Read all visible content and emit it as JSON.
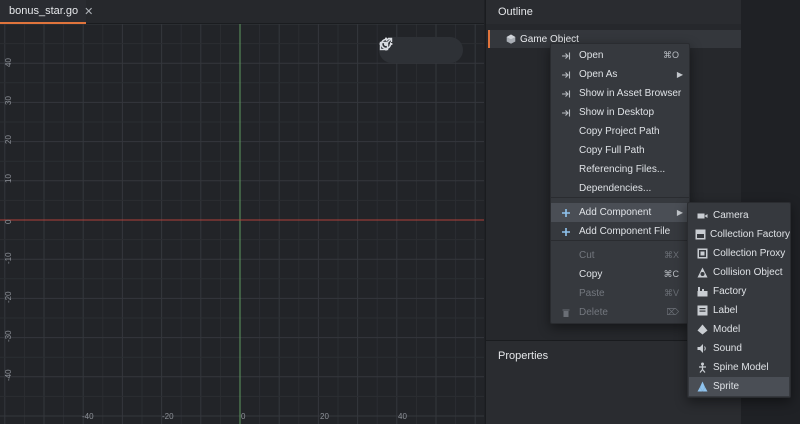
{
  "tab": {
    "label": "bonus_star.go",
    "close": "✕"
  },
  "viewport": {
    "x_ticks": [
      "-40",
      "-20",
      "0",
      "20",
      "40"
    ],
    "y_ticks": [
      "40",
      "30",
      "20",
      "10",
      "0",
      "-10",
      "-20",
      "-30",
      "-40"
    ]
  },
  "outline": {
    "title": "Outline",
    "root_label": "Game Object"
  },
  "properties": {
    "title": "Properties"
  },
  "context_menu": {
    "items": [
      {
        "label": "Open",
        "shortcut": "⌘O",
        "icon": "open-icon",
        "disabled": false
      },
      {
        "label": "Open As",
        "shortcut": "",
        "icon": "open-as-icon",
        "disabled": false,
        "submenu": true
      },
      {
        "label": "Show in Asset Browser",
        "shortcut": "",
        "icon": "show-asset-icon",
        "disabled": false
      },
      {
        "label": "Show in Desktop",
        "shortcut": "",
        "icon": "show-desktop-icon",
        "disabled": false
      },
      {
        "label": "Copy Project Path",
        "shortcut": "",
        "icon": "",
        "disabled": false
      },
      {
        "label": "Copy Full Path",
        "shortcut": "",
        "icon": "",
        "disabled": false
      },
      {
        "label": "Referencing Files...",
        "shortcut": "",
        "icon": "",
        "disabled": false
      },
      {
        "label": "Dependencies...",
        "shortcut": "",
        "icon": "",
        "disabled": false
      },
      {
        "label": "Add Component",
        "shortcut": "",
        "icon": "plus-icon",
        "disabled": false,
        "submenu": true,
        "active": true
      },
      {
        "label": "Add Component File",
        "shortcut": "",
        "icon": "plus-icon",
        "disabled": false
      },
      {
        "label": "Cut",
        "shortcut": "⌘X",
        "icon": "",
        "disabled": true
      },
      {
        "label": "Copy",
        "shortcut": "⌘C",
        "icon": "",
        "disabled": false
      },
      {
        "label": "Paste",
        "shortcut": "⌘V",
        "icon": "",
        "disabled": true
      },
      {
        "label": "Delete",
        "shortcut": "⌦",
        "icon": "trash-icon",
        "disabled": true
      }
    ]
  },
  "submenu": {
    "items": [
      {
        "label": "Camera",
        "icon": "camera-icon"
      },
      {
        "label": "Collection Factory",
        "icon": "collection-factory-icon"
      },
      {
        "label": "Collection Proxy",
        "icon": "collection-proxy-icon"
      },
      {
        "label": "Collision Object",
        "icon": "collision-object-icon"
      },
      {
        "label": "Factory",
        "icon": "factory-icon"
      },
      {
        "label": "Label",
        "icon": "label-icon"
      },
      {
        "label": "Model",
        "icon": "model-icon"
      },
      {
        "label": "Sound",
        "icon": "sound-icon"
      },
      {
        "label": "Spine Model",
        "icon": "spine-model-icon"
      },
      {
        "label": "Sprite",
        "icon": "sprite-icon",
        "active": true
      }
    ]
  },
  "colors": {
    "accent": "#e0743c",
    "x_axis": "#b0413a",
    "y_axis": "#5f9a5f"
  }
}
